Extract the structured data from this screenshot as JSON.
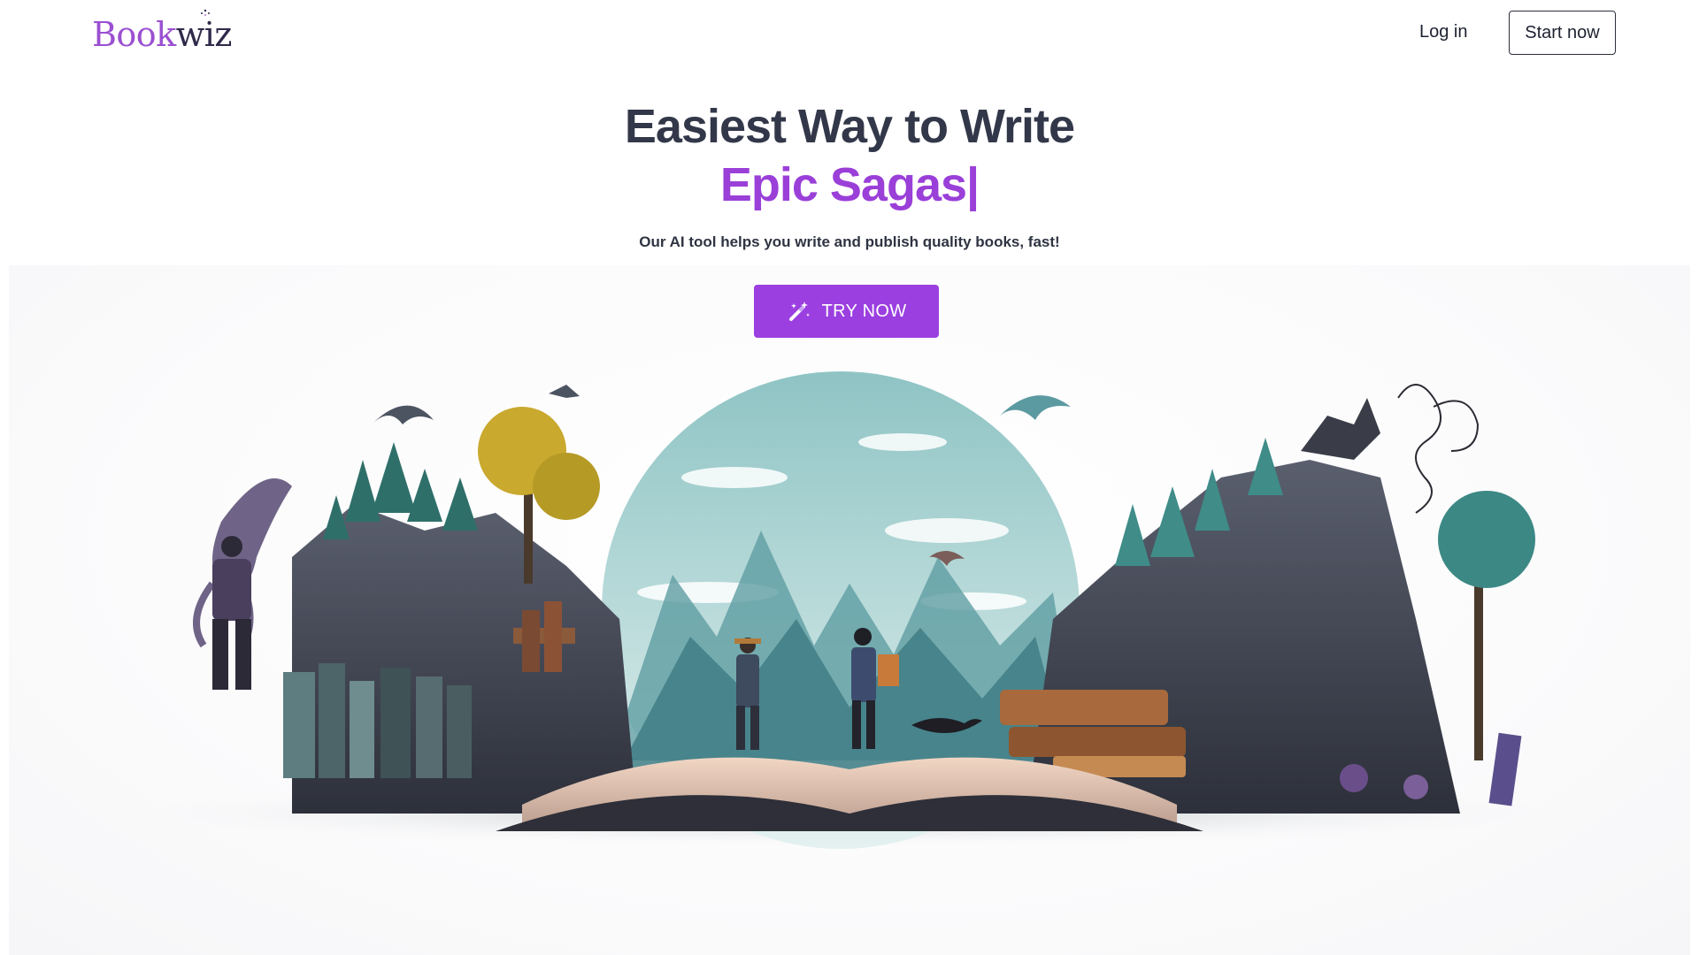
{
  "header": {
    "logo_part1": "Book",
    "logo_part2": "wiz",
    "login_label": "Log in",
    "start_label": "Start now"
  },
  "hero": {
    "headline_line1": "Easiest Way to Write",
    "headline_line2": "Epic Sagas|",
    "subtitle": "Our AI tool helps you write and publish quality books, fast!",
    "cta_label": "TRY NOW",
    "cta_icon": "magic-wand-icon"
  },
  "colors": {
    "brand_purple": "#9b3fe0",
    "headline_dark": "#323849",
    "headline_accent": "#9a3fd8"
  }
}
